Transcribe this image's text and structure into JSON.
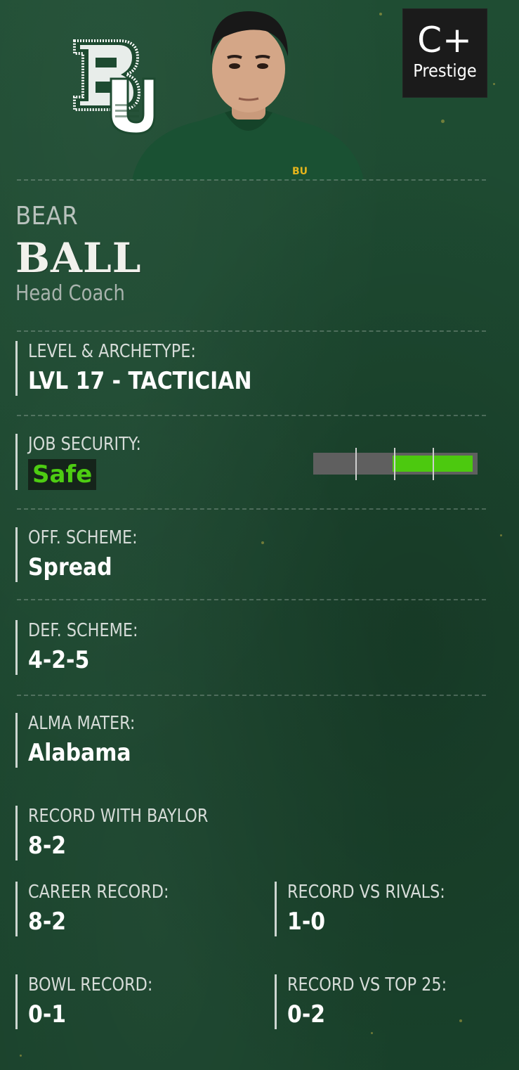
{
  "header": {
    "prestige": {
      "grade": "C+",
      "label": "Prestige"
    },
    "team_logo": "baylor-bu-logo"
  },
  "coach": {
    "first_name": "BEAR",
    "last_name": "BALL",
    "role": "Head Coach"
  },
  "fields": {
    "level_archetype": {
      "label": "LEVEL & ARCHETYPE:",
      "value": "LVL 17 - TACTICIAN"
    },
    "job_security": {
      "label": "JOB SECURITY:",
      "value": "Safe",
      "level": 0.5
    },
    "off_scheme": {
      "label": "OFF. SCHEME:",
      "value": "Spread"
    },
    "def_scheme": {
      "label": "DEF. SCHEME:",
      "value": "4-2-5"
    },
    "alma_mater": {
      "label": "ALMA MATER:",
      "value": "Alabama"
    },
    "record_with_team": {
      "label": "RECORD WITH BAYLOR",
      "value": "8-2"
    },
    "career_record": {
      "label": "CAREER RECORD:",
      "value": "8-2"
    },
    "record_vs_rivals": {
      "label": "RECORD VS RIVALS:",
      "value": "1-0"
    },
    "bowl_record": {
      "label": "BOWL RECORD:",
      "value": "0-1"
    },
    "record_vs_top25": {
      "label": "RECORD VS TOP 25:",
      "value": "0-2"
    }
  },
  "colors": {
    "background": "#1d4a30",
    "safe_green": "#4dcc12",
    "badge_dark": "#1b1b1b",
    "accent_gold": "#e5b51c"
  }
}
